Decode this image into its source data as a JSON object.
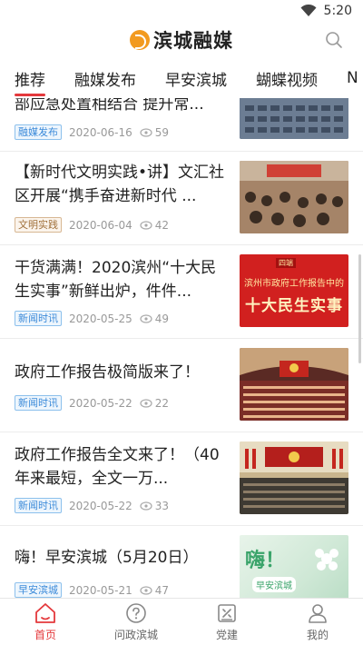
{
  "status_bar": {
    "time": "5:20"
  },
  "header": {
    "app_name": "滨城融媒"
  },
  "tabs": [
    {
      "label": "推荐",
      "active": true
    },
    {
      "label": "融媒发布"
    },
    {
      "label": "早安滨城"
    },
    {
      "label": "蝴蝶视频"
    },
    {
      "label": "N"
    }
  ],
  "articles": [
    {
      "title": "部应急处置相结合 提升常...",
      "badge": "融媒发布",
      "badge_color": "blue",
      "date": "2020-06-16",
      "views": "59"
    },
    {
      "title": "【新时代文明实践•讲】文汇社区开展“携手奋进新时代 ...",
      "badge": "文明实践",
      "badge_color": "brown",
      "date": "2020-06-04",
      "views": "42"
    },
    {
      "title": "干货满满！2020滨州“十大民生实事”新鲜出炉，件件...",
      "badge": "新闻时讯",
      "badge_color": "blue",
      "date": "2020-05-25",
      "views": "49",
      "thumb_text_top": "滨州市政府工作报告中的",
      "thumb_text_main": "十大民生实事",
      "thumb_tag": "四端"
    },
    {
      "title": "政府工作报告极简版来了！",
      "badge": "新闻时讯",
      "badge_color": "blue",
      "date": "2020-05-22",
      "views": "22"
    },
    {
      "title": "政府工作报告全文来了！（40年来最短，全文一万...",
      "badge": "新闻时讯",
      "badge_color": "blue",
      "date": "2020-05-22",
      "views": "33"
    },
    {
      "title": "嗨！早安滨城（5月20日）",
      "badge": "早安滨城",
      "badge_color": "blue",
      "date": "2020-05-21",
      "views": "47",
      "thumb_text_top": "嗨！",
      "thumb_text_main": "早安滨城"
    }
  ],
  "bottom_nav": [
    {
      "label": "首页",
      "icon": "home-icon",
      "active": true
    },
    {
      "label": "问政滨城",
      "icon": "question-icon"
    },
    {
      "label": "党建",
      "icon": "party-building-icon"
    },
    {
      "label": "我的",
      "icon": "profile-icon"
    }
  ],
  "colors": {
    "accent": "#e4393c",
    "badge_blue": "#3b8ad9",
    "badge_brown": "#a0703a",
    "logo_orange": "#f29a1f"
  }
}
